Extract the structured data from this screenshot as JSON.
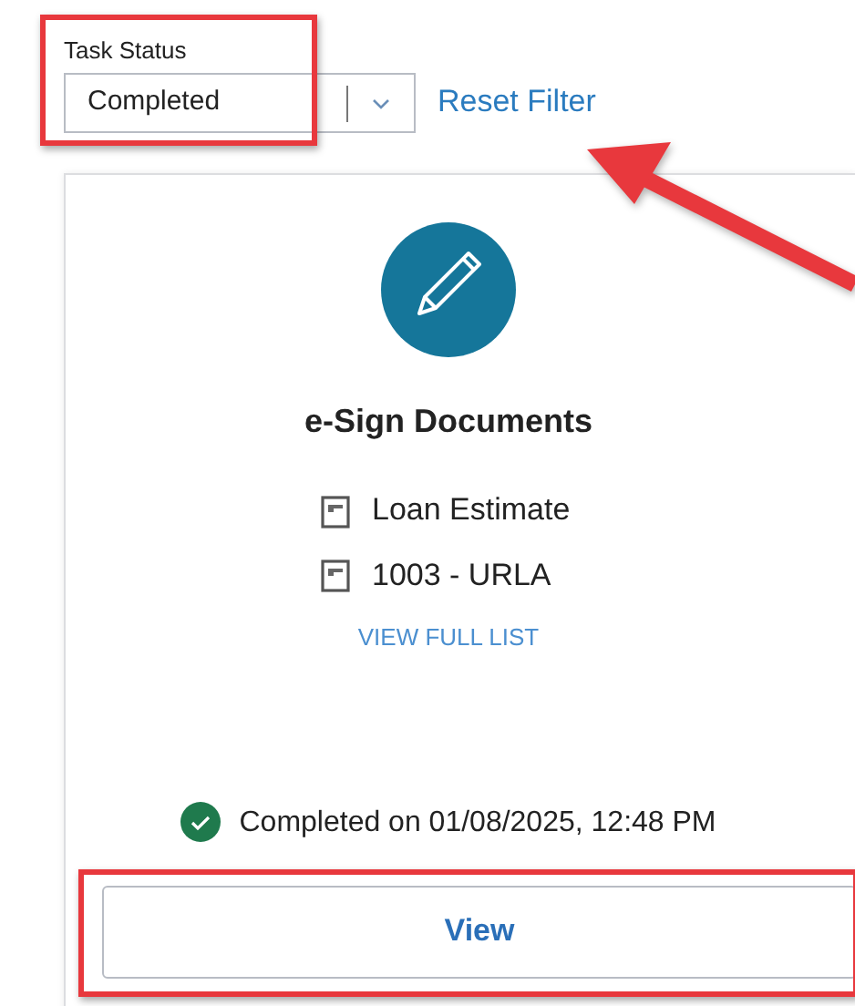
{
  "filter": {
    "label": "Task Status",
    "value": "Completed",
    "highlighted": true,
    "reset_link": "Reset Filter"
  },
  "pointer_arrow": true,
  "task_card": {
    "title": "e-Sign Documents",
    "documents": [
      "Loan Estimate",
      "1003 - URLA"
    ],
    "view_list_link": "VIEW FULL LIST",
    "status": {
      "kind": "completed",
      "text": "Completed on 01/08/2025, 12:48 PM"
    },
    "button": {
      "label": "View",
      "highlighted": true
    }
  }
}
